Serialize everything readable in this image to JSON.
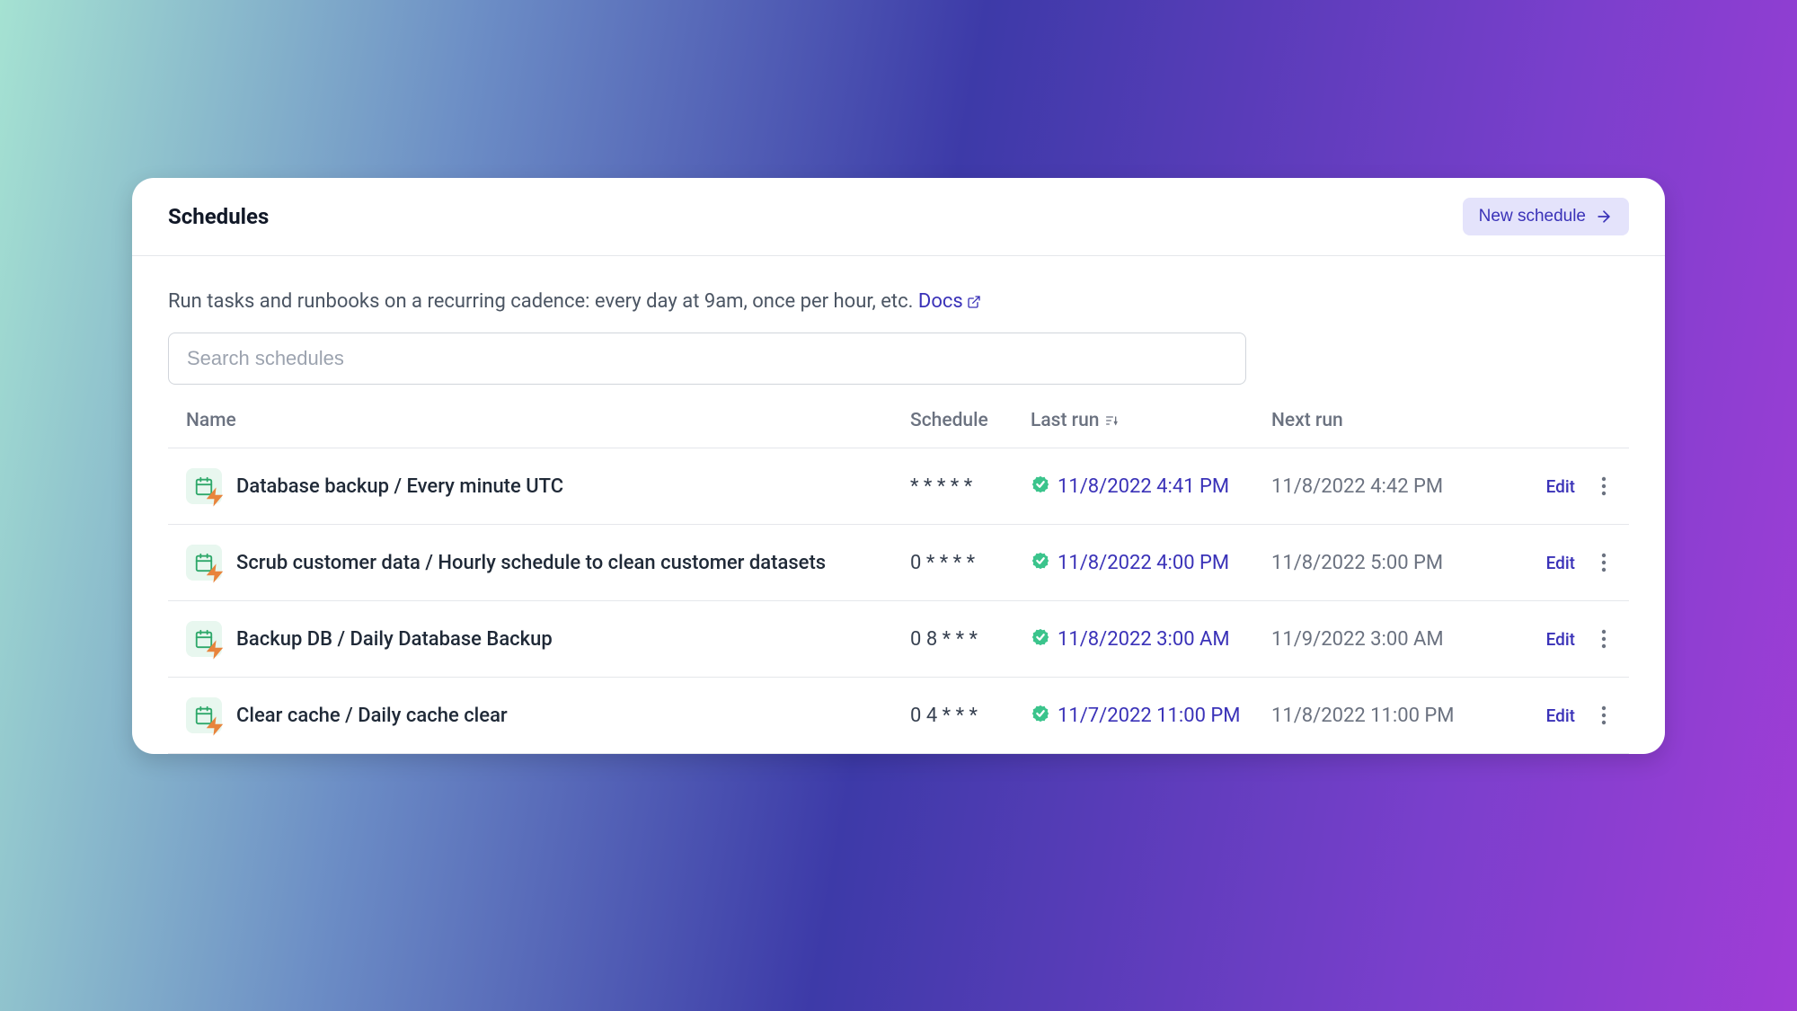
{
  "header": {
    "title": "Schedules",
    "new_button": "New schedule"
  },
  "description": "Run tasks and runbooks on a recurring cadence: every day at 9am, once per hour, etc. ",
  "docs_label": "Docs",
  "search": {
    "placeholder": "Search schedules"
  },
  "columns": {
    "name": "Name",
    "schedule": "Schedule",
    "last_run": "Last run",
    "next_run": "Next run"
  },
  "edit_label": "Edit",
  "rows": [
    {
      "name": "Database backup / Every minute UTC",
      "schedule": "* * * * *",
      "last_run": "11/8/2022 4:41 PM",
      "next_run": "11/8/2022 4:42 PM"
    },
    {
      "name": "Scrub customer data / Hourly schedule to clean customer datasets",
      "schedule": "0 * * * *",
      "last_run": "11/8/2022 4:00 PM",
      "next_run": "11/8/2022 5:00 PM"
    },
    {
      "name": "Backup DB / Daily Database Backup",
      "schedule": "0 8 * * *",
      "last_run": "11/8/2022 3:00 AM",
      "next_run": "11/9/2022 3:00 AM"
    },
    {
      "name": "Clear cache / Daily cache clear",
      "schedule": "0 4 * * *",
      "last_run": "11/7/2022 11:00 PM",
      "next_run": "11/8/2022 11:00 PM"
    }
  ]
}
